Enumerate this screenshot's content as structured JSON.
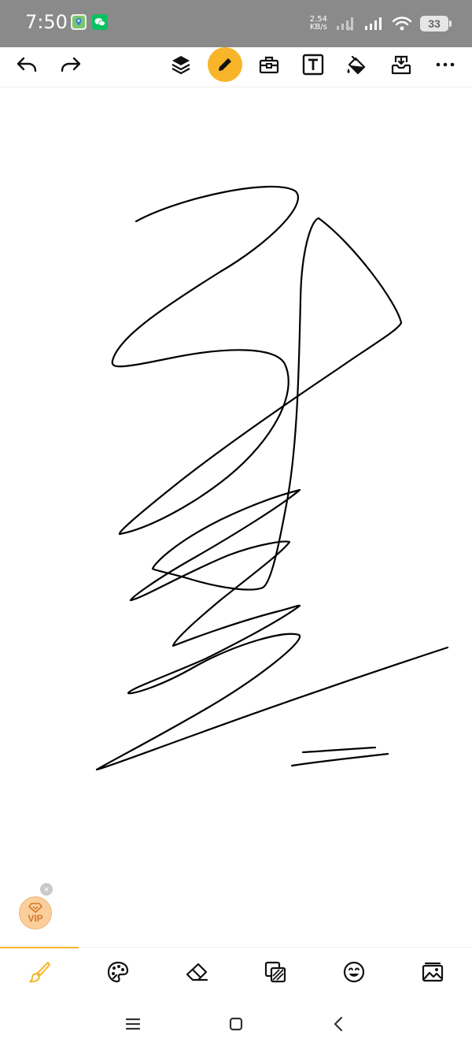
{
  "status_bar": {
    "time": "7:50",
    "network_speed_value": "2.54",
    "network_speed_unit": "KB/s",
    "battery": "33"
  },
  "toolbar": {
    "icons": [
      "undo-icon",
      "redo-icon",
      "layers-icon",
      "pencil-icon",
      "toolbox-icon",
      "text-icon",
      "fill-bucket-icon",
      "save-download-icon",
      "more-icon"
    ],
    "active_tool": "pencil",
    "accent_color": "#F8B52A"
  },
  "vip": {
    "label": "VIP",
    "close_label": "×"
  },
  "bottom_tabs": {
    "items": [
      "brush",
      "palette",
      "eraser",
      "layers-filter",
      "sticker",
      "image"
    ],
    "active": "brush"
  },
  "colors": {
    "status_bar_bg": "#8A8A8A",
    "stroke_color": "#000000",
    "wechat_green": "#07C160"
  }
}
